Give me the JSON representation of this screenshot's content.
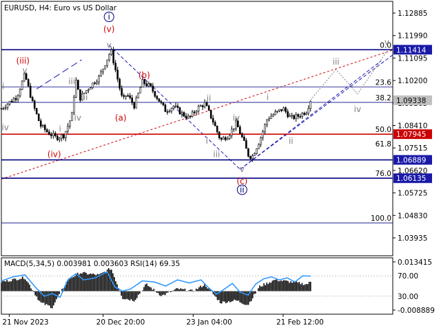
{
  "chart_header": "EURUSD, H4:  Euro vs US Dollar",
  "colors": {
    "frame": "#000000",
    "grid": "#c8c8c8",
    "fib_line": "#000080",
    "price_box": "#1a1aa8",
    "wave_red": "#cc0000",
    "wave_blue": "#000080",
    "wave_gray": "#808080",
    "trend_red": "#cc0000",
    "trend_blue": "#1a1ab0",
    "macd_line": "#3399ff",
    "candle": "#000000"
  },
  "chart_data": {
    "type": "candlestick",
    "symbol": "EURUSD",
    "timeframe": "H4",
    "ylim": [
      1.0295,
      1.134
    ],
    "y_ticks": [
      "1.12885",
      "1.11990",
      "1.11095",
      "1.10200",
      "1.09305",
      "1.08410",
      "1.07515",
      "1.06620",
      "1.05725",
      "1.04830",
      "1.03935"
    ],
    "x_ticks": [
      "21 Nov 2023",
      "20 Dec 20:00",
      "23 Jan 04:00",
      "21 Feb 12:00"
    ],
    "x_tick_positions": [
      0.02,
      0.26,
      0.49,
      0.72
    ],
    "price_path": [
      [
        0.0,
        1.09
      ],
      [
        0.02,
        1.0925
      ],
      [
        0.04,
        1.095
      ],
      [
        0.06,
        1.104
      ],
      [
        0.08,
        1.092
      ],
      [
        0.1,
        1.083
      ],
      [
        0.12,
        1.08
      ],
      [
        0.14,
        1.078
      ],
      [
        0.16,
        1.079
      ],
      [
        0.18,
        1.087
      ],
      [
        0.19,
        1.102
      ],
      [
        0.2,
        1.094
      ],
      [
        0.22,
        1.098
      ],
      [
        0.25,
        1.103
      ],
      [
        0.28,
        1.1139
      ],
      [
        0.3,
        1.1
      ],
      [
        0.31,
        1.093
      ],
      [
        0.32,
        1.096
      ],
      [
        0.34,
        1.091
      ],
      [
        0.36,
        1.101
      ],
      [
        0.38,
        1.099
      ],
      [
        0.4,
        1.094
      ],
      [
        0.42,
        1.089
      ],
      [
        0.44,
        1.091
      ],
      [
        0.46,
        1.088
      ],
      [
        0.48,
        1.086
      ],
      [
        0.5,
        1.09
      ],
      [
        0.52,
        1.092
      ],
      [
        0.54,
        1.085
      ],
      [
        0.56,
        1.077
      ],
      [
        0.58,
        1.079
      ],
      [
        0.6,
        1.084
      ],
      [
        0.62,
        1.076
      ],
      [
        0.63,
        1.071
      ],
      [
        0.64,
        1.07
      ],
      [
        0.66,
        1.077
      ],
      [
        0.68,
        1.086
      ],
      [
        0.7,
        1.088
      ],
      [
        0.72,
        1.09
      ],
      [
        0.74,
        1.086
      ],
      [
        0.76,
        1.087
      ],
      [
        0.78,
        1.089
      ],
      [
        0.79,
        1.0935
      ]
    ],
    "fib_levels": [
      {
        "label": "0.0",
        "price": 1.11414
      },
      {
        "label": "23.6",
        "price": 1.0988
      },
      {
        "label": "38.2",
        "price": 1.0925
      },
      {
        "label": "50.0",
        "price": 1.07945
      },
      {
        "label": "61.8",
        "price": 1.0735
      },
      {
        "label": "76.0",
        "price": 1.06135
      },
      {
        "label": "100.0",
        "price": 1.043
      }
    ],
    "price_labels": [
      {
        "text": "1.11414",
        "price": 1.11414,
        "kind": "box"
      },
      {
        "text": "1.09338",
        "price": 1.09338,
        "kind": "gray"
      },
      {
        "text": "1.07945",
        "price": 1.07945,
        "kind": "red"
      },
      {
        "text": "1.06889",
        "price": 1.06889,
        "kind": "box"
      },
      {
        "text": "1.06135",
        "price": 1.06135,
        "kind": "box"
      }
    ],
    "fib_lines": [
      {
        "price": 1.11414,
        "color": "#000080",
        "width": 1.6
      },
      {
        "price": 1.0988,
        "color": "#000080",
        "width": 0.8
      },
      {
        "price": 1.0925,
        "color": "#000080",
        "width": 0.8
      },
      {
        "price": 1.07945,
        "color": "#cc0000",
        "width": 1.6
      },
      {
        "price": 1.06889,
        "color": "#000080",
        "width": 1.6
      },
      {
        "price": 1.06135,
        "color": "#000080",
        "width": 1.6
      },
      {
        "price": 1.043,
        "color": "#000080",
        "width": 0.8
      }
    ],
    "wave_labels": [
      {
        "text": "i",
        "t": 0.005,
        "p": 1.098,
        "style": "gray"
      },
      {
        "text": "iv",
        "t": 0.01,
        "p": 1.081,
        "style": "gray"
      },
      {
        "text": "(iii)",
        "t": 0.055,
        "p": 1.1085,
        "style": "red"
      },
      {
        "text": "v",
        "t": 0.06,
        "p": 1.1045,
        "style": "gray"
      },
      {
        "text": "i",
        "t": 0.15,
        "p": 1.0805,
        "style": "gray"
      },
      {
        "text": "(iv)",
        "t": 0.135,
        "p": 1.07,
        "style": "red"
      },
      {
        "text": "iii",
        "t": 0.18,
        "p": 1.1,
        "style": "gray"
      },
      {
        "text": "iv",
        "t": 0.195,
        "p": 1.085,
        "style": "gray"
      },
      {
        "text": "ii",
        "t": 0.215,
        "p": 1.0935,
        "style": "gray"
      },
      {
        "text": "i",
        "t": 0.275,
        "p": 1.1265,
        "style": "circled"
      },
      {
        "text": "(v)",
        "t": 0.275,
        "p": 1.1215,
        "style": "red"
      },
      {
        "text": "v",
        "t": 0.275,
        "p": 1.115,
        "style": "gray"
      },
      {
        "text": "(a)",
        "t": 0.305,
        "p": 1.085,
        "style": "red"
      },
      {
        "text": "(b)",
        "t": 0.365,
        "p": 1.1025,
        "style": "red"
      },
      {
        "text": "ii",
        "t": 0.53,
        "p": 1.093,
        "style": "gray"
      },
      {
        "text": "iv",
        "t": 0.6,
        "p": 1.085,
        "style": "gray"
      },
      {
        "text": "i",
        "t": 0.525,
        "p": 1.0755,
        "style": "gray"
      },
      {
        "text": "iii",
        "t": 0.55,
        "p": 1.07,
        "style": "gray"
      },
      {
        "text": "v",
        "t": 0.615,
        "p": 1.064,
        "style": "gray"
      },
      {
        "text": "(c)",
        "t": 0.615,
        "p": 1.059,
        "style": "red"
      },
      {
        "text": "ii",
        "t": 0.615,
        "p": 1.0555,
        "style": "circled"
      },
      {
        "text": "i",
        "t": 0.68,
        "p": 1.0935,
        "style": "gray"
      },
      {
        "text": "ii",
        "t": 0.74,
        "p": 1.0755,
        "style": "gray"
      },
      {
        "text": "iii",
        "t": 0.855,
        "p": 1.108,
        "style": "gray"
      },
      {
        "text": "iv",
        "t": 0.91,
        "p": 1.0885,
        "style": "gray"
      },
      {
        "text": "v",
        "t": 0.985,
        "p": 1.116,
        "style": "gray"
      }
    ],
    "trend_lines": [
      {
        "from": [
          0.0,
          1.061
        ],
        "to": [
          1.0,
          1.114
        ],
        "color": "#cc0000",
        "dash": "3,3"
      },
      {
        "from": [
          0.09,
          1.098
        ],
        "to": [
          0.205,
          1.11
        ],
        "color": "#1a1ab0",
        "dash": "10,5"
      },
      {
        "from": [
          0.275,
          1.116
        ],
        "to": [
          0.61,
          1.065
        ],
        "color": "#1a1ab0",
        "dash": "5,3"
      },
      {
        "from": [
          0.61,
          1.065
        ],
        "to": [
          1.0,
          1.112
        ],
        "color": "#1a1ab0",
        "dash": "5,3"
      },
      {
        "from": [
          0.61,
          1.065
        ],
        "to": [
          0.97,
          1.1095
        ],
        "color": "#1a1ab0",
        "dash": "5,3"
      }
    ],
    "projection_path": [
      [
        0.79,
        1.0935
      ],
      [
        0.855,
        1.106
      ],
      [
        0.91,
        1.096
      ],
      [
        0.985,
        1.1135
      ]
    ],
    "indicator": {
      "title": "MACD(5,34,5) 0.003981 0.003603 RSI(14) 69.35",
      "right_ticks": [
        "0.013415",
        "-0.008889"
      ],
      "left_ticks": [
        "70.00",
        "30.00"
      ],
      "ylim": [
        -0.01,
        0.0145
      ],
      "rsi_ylim": [
        0,
        100
      ],
      "macd_path": [
        [
          0.0,
          0.004
        ],
        [
          0.06,
          0.006
        ],
        [
          0.1,
          -0.005
        ],
        [
          0.13,
          -0.007
        ],
        [
          0.17,
          0.005
        ],
        [
          0.2,
          0.008
        ],
        [
          0.25,
          0.007
        ],
        [
          0.28,
          0.01
        ],
        [
          0.31,
          -0.003
        ],
        [
          0.34,
          -0.004
        ],
        [
          0.37,
          0.003
        ],
        [
          0.41,
          -0.002
        ],
        [
          0.45,
          0.001
        ],
        [
          0.49,
          0.0
        ],
        [
          0.52,
          0.003
        ],
        [
          0.56,
          -0.005
        ],
        [
          0.6,
          -0.004
        ],
        [
          0.63,
          -0.006
        ],
        [
          0.66,
          0.002
        ],
        [
          0.7,
          0.005
        ],
        [
          0.74,
          0.004
        ],
        [
          0.78,
          0.003
        ],
        [
          0.79,
          0.004
        ]
      ],
      "rsi_path": [
        [
          0.0,
          60
        ],
        [
          0.03,
          68
        ],
        [
          0.06,
          72
        ],
        [
          0.09,
          45
        ],
        [
          0.11,
          30
        ],
        [
          0.13,
          35
        ],
        [
          0.15,
          28
        ],
        [
          0.17,
          62
        ],
        [
          0.19,
          74
        ],
        [
          0.21,
          62
        ],
        [
          0.24,
          66
        ],
        [
          0.27,
          78
        ],
        [
          0.29,
          48
        ],
        [
          0.31,
          40
        ],
        [
          0.33,
          44
        ],
        [
          0.36,
          60
        ],
        [
          0.39,
          58
        ],
        [
          0.42,
          50
        ],
        [
          0.45,
          62
        ],
        [
          0.48,
          56
        ],
        [
          0.51,
          62
        ],
        [
          0.53,
          46
        ],
        [
          0.55,
          34
        ],
        [
          0.57,
          44
        ],
        [
          0.59,
          55
        ],
        [
          0.61,
          38
        ],
        [
          0.63,
          32
        ],
        [
          0.65,
          54
        ],
        [
          0.67,
          64
        ],
        [
          0.69,
          68
        ],
        [
          0.71,
          62
        ],
        [
          0.73,
          66
        ],
        [
          0.75,
          58
        ],
        [
          0.77,
          70
        ],
        [
          0.79,
          69.35
        ]
      ]
    }
  }
}
